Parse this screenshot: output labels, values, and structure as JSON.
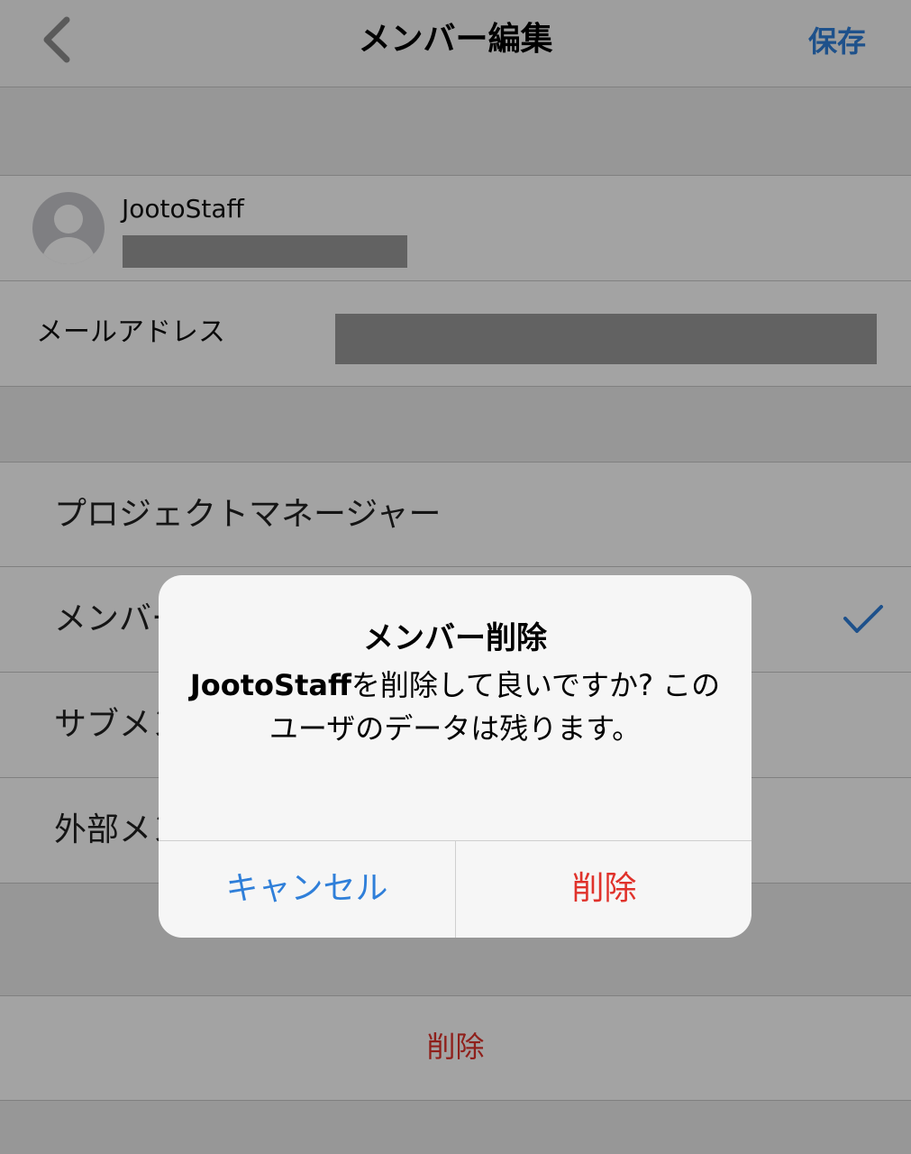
{
  "nav": {
    "title": "メンバー編集",
    "save_label": "保存"
  },
  "user": {
    "name": "JootoStaff"
  },
  "email": {
    "label": "メールアドレス"
  },
  "roles": [
    {
      "label": "プロジェクトマネージャー",
      "selected": false
    },
    {
      "label": "メンバー",
      "selected": true
    },
    {
      "label": "サブメンバー",
      "selected": false
    },
    {
      "label": "外部メンバー",
      "selected": false
    }
  ],
  "delete_row": {
    "label": "削除"
  },
  "dialog": {
    "title": "メンバー削除",
    "message_name": "JootoStaff",
    "message_rest": "を削除して良いですか? このユーザのデータは残ります。",
    "cancel_label": "キャンセル",
    "delete_label": "削除"
  },
  "colors": {
    "accent": "#2f7fd9",
    "danger": "#e0322b"
  }
}
